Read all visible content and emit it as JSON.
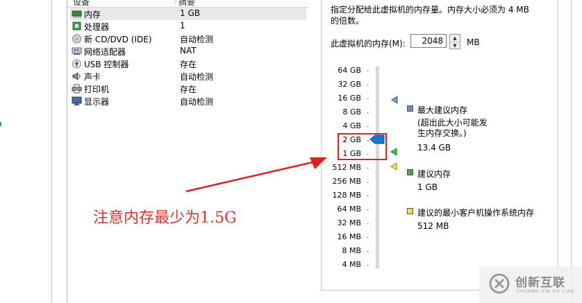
{
  "device_table": {
    "headers": [
      "设备",
      "摘要"
    ],
    "rows": [
      {
        "icon": "memory-icon",
        "name": "内存",
        "value": "1 GB",
        "selected": true
      },
      {
        "icon": "processor-icon",
        "name": "处理器",
        "value": "1"
      },
      {
        "icon": "cd-dvd-icon",
        "name": "新 CD/DVD (IDE)",
        "value": "自动检测"
      },
      {
        "icon": "network-adapter-icon",
        "name": "网络适配器",
        "value": "NAT"
      },
      {
        "icon": "usb-icon",
        "name": "USB 控制器",
        "value": "存在"
      },
      {
        "icon": "sound-card-icon",
        "name": "声卡",
        "value": "自动检测"
      },
      {
        "icon": "printer-icon",
        "name": "打印机",
        "value": "存在"
      },
      {
        "icon": "display-icon",
        "name": "显示器",
        "value": "自动检测"
      }
    ]
  },
  "memory": {
    "description": "指定分配给此虚拟机的内存量。内存大小必须为 4 MB 的倍数。",
    "label": "此虚拟机的内存(M):",
    "value": "2048",
    "unit": "MB",
    "scale_labels": [
      "64 GB",
      "32 GB",
      "16 GB",
      "8 GB",
      "4 GB",
      "2 GB",
      "1 GB",
      "512 MB",
      "256 MB",
      "128 MB",
      "64 MB",
      "32 MB",
      "16 MB",
      "8 MB",
      "4 MB"
    ],
    "current_level": "2 GB",
    "legend": {
      "max": {
        "title": "最大建议内存",
        "note": "(超出此大小可能发生内存交换。)",
        "value": "13.4 GB",
        "color": "#6b8cc7"
      },
      "recommended": {
        "title": "建议内存",
        "value": "1 GB",
        "color": "#2fb24a"
      },
      "min_guest": {
        "title": "建议的最小客户机操作系统内存",
        "value": "512 MB",
        "color": "#f0e040"
      }
    }
  },
  "annotation": {
    "text": "注意内存最少为1.5G",
    "color": "#e03030"
  },
  "watermark": {
    "title": "创新互联",
    "subtitle": "CHUANG XIN HU LIAN"
  }
}
